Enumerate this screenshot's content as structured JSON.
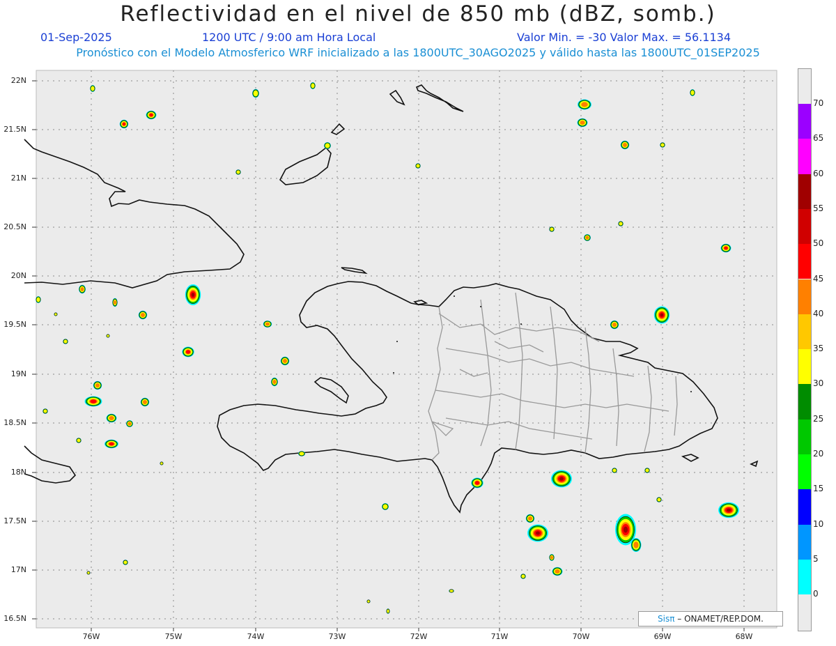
{
  "title": "Reflectividad en el nivel de 850 mb (dBZ, somb.)",
  "header": {
    "date": "01-Sep-2025",
    "time": "1200 UTC / 9:00 am Hora Local",
    "minmax": "Valor Min. = -30  Valor Max. = 56.1134",
    "subtitle": "Pronóstico con el Modelo Atmosferico WRF inicializado a las 1800UTC_30AGO2025 y válido hasta las  1800UTC_01SEP2025"
  },
  "lat_ticks": [
    "22N",
    "21.5N",
    "21N",
    "20.5N",
    "20N",
    "19.5N",
    "19N",
    "18.5N",
    "18N",
    "17.5N",
    "17N",
    "16.5N"
  ],
  "lon_ticks": [
    "76W",
    "75W",
    "74W",
    "73W",
    "72W",
    "71W",
    "70W",
    "69W",
    "68W"
  ],
  "colorbar": {
    "labels": [
      "70",
      "65",
      "60",
      "55",
      "50",
      "45",
      "40",
      "35",
      "30",
      "25",
      "20",
      "15",
      "10",
      "5",
      "0"
    ],
    "colors": [
      "#9b00ff",
      "#ff00ff",
      "#a00000",
      "#d00000",
      "#ff0000",
      "#ff8000",
      "#ffc800",
      "#ffff00",
      "#008c00",
      "#00c800",
      "#00ff00",
      "#0000ff",
      "#0096ff",
      "#00ffff"
    ]
  },
  "credit": {
    "brand": "Sisπ",
    "text": "– ONAMET/REP.DOM."
  }
}
